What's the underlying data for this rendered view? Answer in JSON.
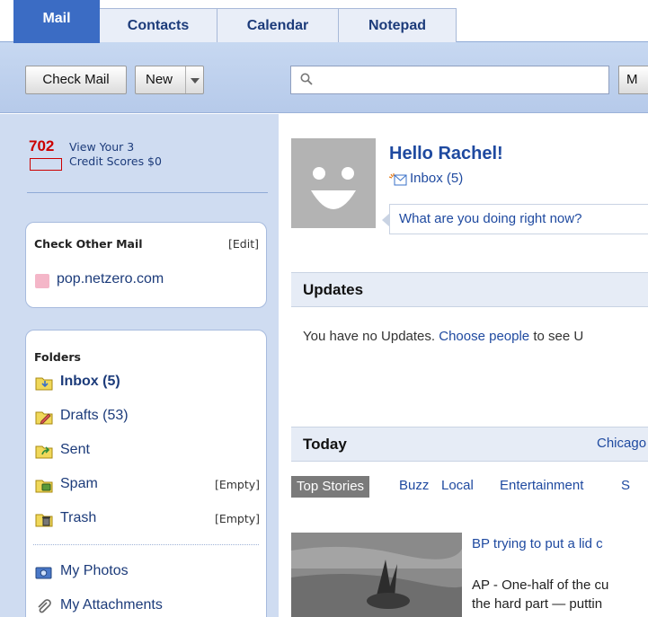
{
  "tabs": [
    {
      "label": "Mail",
      "active": true
    },
    {
      "label": "Contacts",
      "active": false
    },
    {
      "label": "Calendar",
      "active": false
    },
    {
      "label": "Notepad",
      "active": false
    }
  ],
  "toolbar": {
    "check_mail_label": "Check Mail",
    "new_label": "New",
    "search_placeholder": "",
    "search_button_label": "M"
  },
  "credit": {
    "score": "702",
    "line1": "View Your 3",
    "line2": "Credit Scores $0"
  },
  "check_other_mail": {
    "title": "Check Other Mail",
    "edit_label": "[Edit]",
    "account": "pop.netzero.com"
  },
  "folders": {
    "title": "Folders",
    "items": [
      {
        "label": "Inbox (5)",
        "icon": "inbox-folder-icon",
        "bold": true,
        "action": ""
      },
      {
        "label": "Drafts (53)",
        "icon": "drafts-folder-icon",
        "bold": false,
        "action": ""
      },
      {
        "label": "Sent",
        "icon": "sent-folder-icon",
        "bold": false,
        "action": ""
      },
      {
        "label": "Spam",
        "icon": "spam-folder-icon",
        "bold": false,
        "action": "[Empty]"
      },
      {
        "label": "Trash",
        "icon": "trash-folder-icon",
        "bold": false,
        "action": "[Empty]"
      }
    ],
    "extras": [
      {
        "label": "My Photos",
        "icon": "photos-icon"
      },
      {
        "label": "My Attachments",
        "icon": "paperclip-icon"
      }
    ]
  },
  "profile": {
    "greeting": "Hello Rachel!",
    "inbox_link": "Inbox (5)",
    "status_prompt": "What are you doing right now?"
  },
  "updates": {
    "title": "Updates",
    "text_before": "You have no Updates. ",
    "link": "Choose people",
    "text_after": " to see U"
  },
  "today": {
    "title": "Today",
    "location": "Chicago",
    "news_tabs": [
      "Top Stories",
      "Buzz",
      "Local",
      "Entertainment",
      "S"
    ],
    "headline": "BP trying to put a lid c",
    "body_line1": "AP - One-half of the cu",
    "body_line2": "the hard part — puttin"
  },
  "colors": {
    "active_tab": "#3b6cc4",
    "toolbar": "#c7d8f1",
    "sidebar": "#cfdcf1",
    "link": "#1f4aa0",
    "credit_red": "#cc0000"
  }
}
